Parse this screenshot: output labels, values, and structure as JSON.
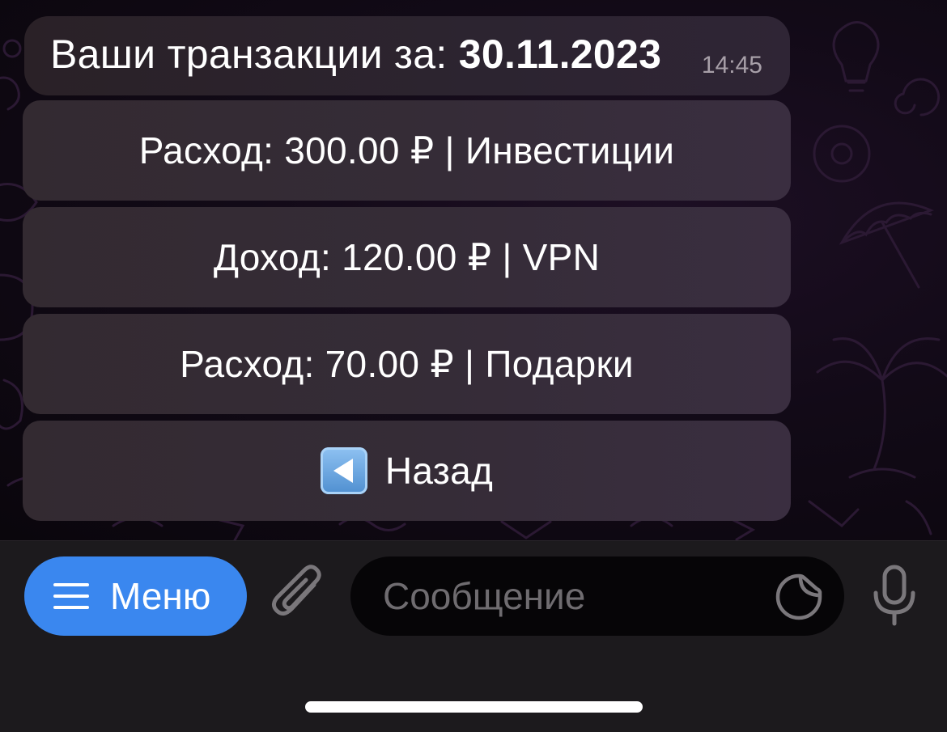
{
  "message": {
    "text_prefix": "Ваши транзакции за: ",
    "date": "30.11.2023",
    "time": "14:45"
  },
  "inline_buttons": [
    {
      "label": "Расход: 300.00 ₽ | Инвестиции"
    },
    {
      "label": "Доход: 120.00 ₽ | VPN"
    },
    {
      "label": "Расход: 70.00 ₽ | Подарки"
    },
    {
      "label": "Назад",
      "icon": "back-arrow-emoji-icon"
    }
  ],
  "bottom_bar": {
    "menu_label": "Меню",
    "input_placeholder": "Сообщение"
  },
  "icons": {
    "menu": "hamburger-icon",
    "attach": "paperclip-icon",
    "sticker": "sticker-icon",
    "mic": "microphone-icon"
  },
  "colors": {
    "menu_button": "#3a87ef",
    "bubble": "#2c2430",
    "inline_button": "#352c37",
    "bar": "#1c1a1d"
  }
}
